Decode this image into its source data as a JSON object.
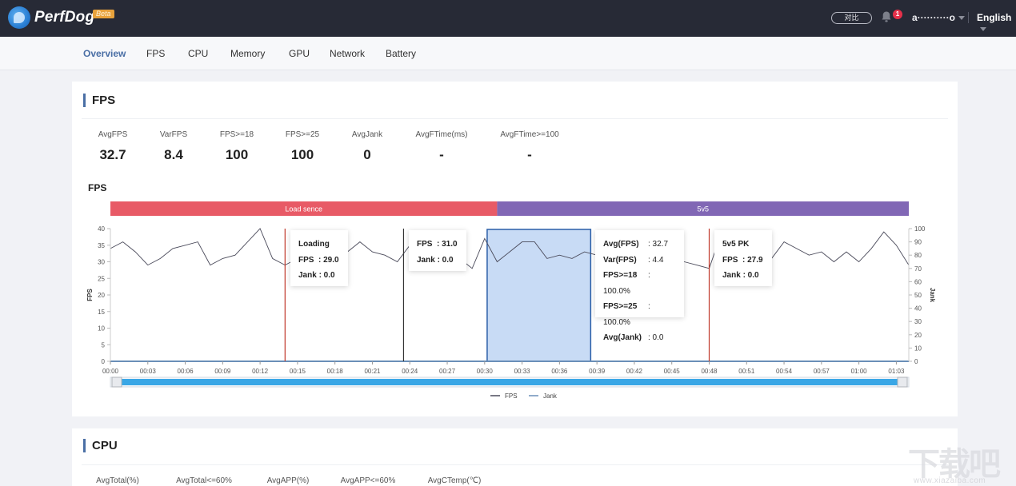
{
  "app": {
    "name": "PerfDog",
    "badge": "Beta"
  },
  "header": {
    "compare_label": "对比",
    "notification_count": "1",
    "username": "a··········o",
    "language": "English"
  },
  "tabs": [
    {
      "label": "Overview",
      "active": true
    },
    {
      "label": "FPS",
      "active": false
    },
    {
      "label": "CPU",
      "active": false
    },
    {
      "label": "Memory",
      "active": false
    },
    {
      "label": "GPU",
      "active": false
    },
    {
      "label": "Network",
      "active": false
    },
    {
      "label": "Battery",
      "active": false
    }
  ],
  "fps_section": {
    "title": "FPS",
    "stats": [
      {
        "label": "AvgFPS",
        "value": "32.7"
      },
      {
        "label": "VarFPS",
        "value": "8.4"
      },
      {
        "label": "FPS>=18",
        "value": "100"
      },
      {
        "label": "FPS>=25",
        "value": "100"
      },
      {
        "label": "AvgJank",
        "value": "0"
      },
      {
        "label": "AvgFTime(ms)",
        "value": "-"
      },
      {
        "label": "AvgFTime>=100",
        "value": "-"
      }
    ],
    "chart_title": "FPS"
  },
  "cpu_section": {
    "title": "CPU",
    "stats": [
      {
        "label": "AvgTotal(%)"
      },
      {
        "label": "AvgTotal<=60%"
      },
      {
        "label": "AvgAPP(%)"
      },
      {
        "label": "AvgAPP<=60%"
      },
      {
        "label": "AvgCTemp(℃)"
      }
    ]
  },
  "tooltips": {
    "loading": {
      "title": "Loading",
      "fps_label": "FPS",
      "fps": ": 29.0",
      "jank_label": "Jank",
      "jank": ": 0.0"
    },
    "hover": {
      "fps_label": "FPS",
      "fps": ": 31.0",
      "jank_label": "Jank",
      "jank": ": 0.0"
    },
    "selection": {
      "rows": [
        {
          "label": "Avg(FPS)",
          "value": ": 32.7"
        },
        {
          "label": "Var(FPS)",
          "value": ": 4.4"
        },
        {
          "label": "FPS>=18",
          "value": ": 100.0%"
        },
        {
          "label": "FPS>=25",
          "value": ": 100.0%"
        },
        {
          "label": "Avg(Jank)",
          "value": ": 0.0"
        }
      ]
    },
    "pk": {
      "title": "5v5 PK",
      "fps_label": "FPS",
      "fps": ": 27.9",
      "jank_label": "Jank",
      "jank": ": 0.0"
    }
  },
  "watermark": {
    "text": "下载吧",
    "url": "www.xiazaiba.com"
  },
  "colors": {
    "accent": "#4a6fa5",
    "scene_load": "#e85a66",
    "scene_5v5": "#8167b5",
    "marker_red": "#c0392b",
    "marker_dark": "#333333",
    "selection_fill": "#c8dbf5",
    "selection_stroke": "#2a5ea8",
    "fps_line": "#4a4a5a",
    "jank_line": "#6a8fb8",
    "slider": "#3aa7e6"
  },
  "chart_data": {
    "type": "line",
    "title": "FPS",
    "xlabel": "",
    "ylabel": "FPS",
    "y2label": "Jank",
    "ylim": [
      0,
      40
    ],
    "y2lim": [
      0,
      100
    ],
    "yticks": [
      0,
      5,
      10,
      15,
      20,
      25,
      30,
      35,
      40
    ],
    "y2ticks": [
      0,
      10,
      20,
      30,
      40,
      50,
      60,
      70,
      80,
      90,
      100
    ],
    "xticks": [
      "00:00",
      "00:03",
      "00:06",
      "00:09",
      "00:12",
      "00:15",
      "00:18",
      "00:21",
      "00:24",
      "00:27",
      "00:30",
      "00:33",
      "00:36",
      "00:39",
      "00:42",
      "00:45",
      "00:48",
      "00:51",
      "00:54",
      "00:57",
      "01:00",
      "01:03"
    ],
    "x_seconds_range": [
      0,
      64
    ],
    "scenes": [
      {
        "name": "Load sence",
        "start": 0,
        "end": 31
      },
      {
        "name": "5v5",
        "start": 31,
        "end": 64
      }
    ],
    "markers": [
      {
        "t": 14,
        "style": "red"
      },
      {
        "t": 23.5,
        "style": "dark"
      },
      {
        "t": 48,
        "style": "red"
      }
    ],
    "selection": {
      "start": 30.2,
      "end": 38.5
    },
    "legend": [
      "FPS",
      "Jank"
    ],
    "legend_position": "bottom-center",
    "series": [
      {
        "name": "FPS",
        "axis": "left",
        "values": [
          34,
          36,
          33,
          29,
          31,
          34,
          35,
          36,
          29,
          31,
          32,
          36,
          40,
          31,
          29,
          31,
          33,
          30,
          31,
          33,
          36,
          33,
          32,
          30,
          35,
          31,
          33,
          30,
          31,
          28,
          37,
          30,
          33,
          36,
          36,
          31,
          32,
          31,
          33,
          32,
          31,
          32,
          32,
          32,
          32,
          31,
          30,
          29,
          28,
          39,
          30,
          32,
          35,
          31,
          36,
          34,
          32,
          33,
          30,
          33,
          30,
          34,
          39,
          35,
          29
        ]
      },
      {
        "name": "Jank",
        "axis": "right",
        "values": [
          0,
          0,
          0,
          0,
          0,
          0,
          0,
          0,
          0,
          0,
          0,
          0,
          0,
          0,
          0,
          0,
          0,
          0,
          0,
          0,
          0,
          0,
          0,
          0,
          0,
          0,
          0,
          0,
          0,
          0,
          0,
          0,
          0,
          0,
          0,
          0,
          0,
          0,
          0,
          0,
          0,
          0,
          0,
          0,
          0,
          0,
          0,
          0,
          0,
          0,
          0,
          0,
          0,
          0,
          0,
          0,
          0,
          0,
          0,
          0,
          0,
          0,
          0,
          0,
          0
        ]
      }
    ]
  }
}
